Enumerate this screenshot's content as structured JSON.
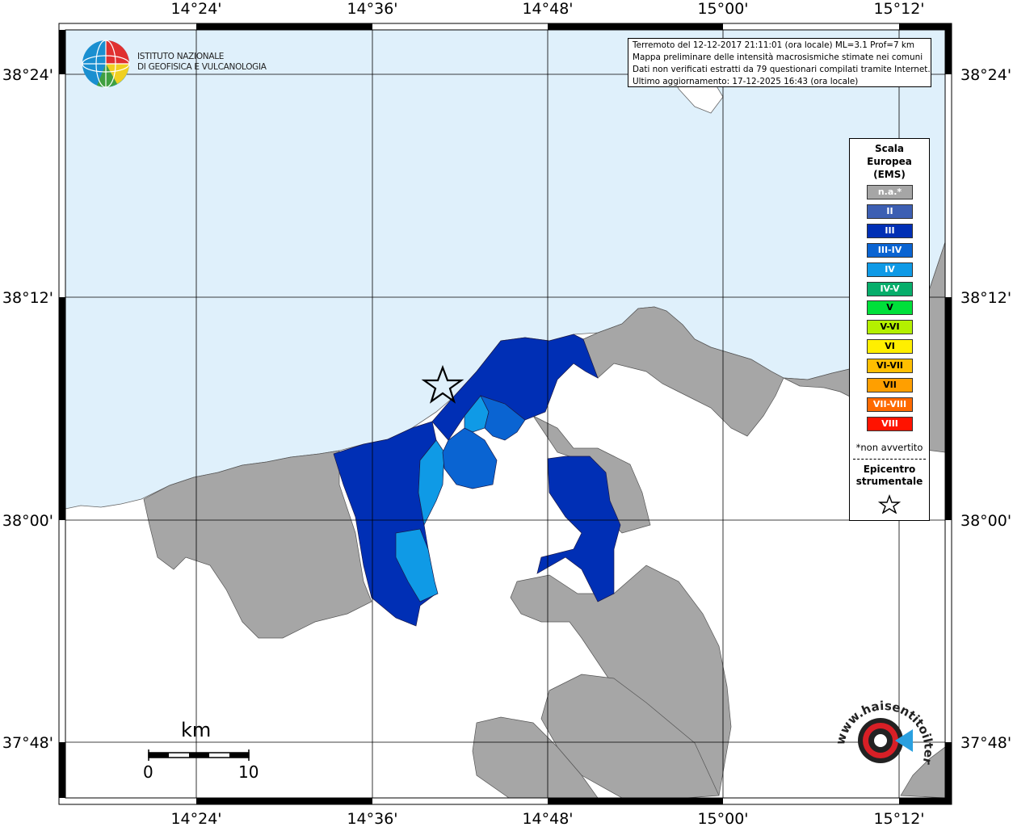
{
  "map": {
    "lon_ticks": [
      "14°24'",
      "14°36'",
      "14°48'",
      "15°00'",
      "15°12'"
    ],
    "lat_ticks": [
      "38°24'",
      "38°12'",
      "38°00'",
      "37°48'"
    ],
    "colors": {
      "sea": "#dff0fb",
      "not_available": "#a6a6a6",
      "III": "#002fb5",
      "III-IV": "#0a64d2",
      "IV": "#0f9ae6"
    }
  },
  "logo": {
    "line1": "ISTITUTO NAZIONALE",
    "line2": "DI GEOFISICA E VULCANOLOGIA"
  },
  "info": {
    "line1": "Terremoto del 12-12-2017 21:11:01 (ora locale) ML=3.1 Prof=7 km",
    "line2": "Mappa preliminare delle intensità macrosismiche stimate nei comuni",
    "line3": "Dati non verificati estratti da 79 questionari compilati tramite Internet.",
    "line4": "Ultimo aggiornamento: 17-12-2025 16:43 (ora locale)"
  },
  "legend": {
    "title": "Scala\nEuropea\n(EMS)",
    "items": [
      {
        "label": "n.a.*",
        "color": "#a6a6a6"
      },
      {
        "label": "II",
        "color": "#3d5fb3"
      },
      {
        "label": "III",
        "color": "#002fb5"
      },
      {
        "label": "III-IV",
        "color": "#0a64d2"
      },
      {
        "label": "IV",
        "color": "#0f9ae6"
      },
      {
        "label": "IV-V",
        "color": "#07ae6b"
      },
      {
        "label": "V",
        "color": "#00e03a"
      },
      {
        "label": "V-VI",
        "color": "#b4f000"
      },
      {
        "label": "VI",
        "color": "#ffef00"
      },
      {
        "label": "VI-VII",
        "color": "#ffbf00"
      },
      {
        "label": "VII",
        "color": "#ff9f00"
      },
      {
        "label": "VII-VIII",
        "color": "#ff6a00"
      },
      {
        "label": "VIII",
        "color": "#ff1300"
      }
    ],
    "note": "*non avvertito",
    "epicenter": "Epicentro\nstrumentale"
  },
  "scalebar": {
    "unit": "km",
    "min": "0",
    "max": "10"
  },
  "watermark": {
    "text": "www.haisentitoilterremoto.it"
  }
}
